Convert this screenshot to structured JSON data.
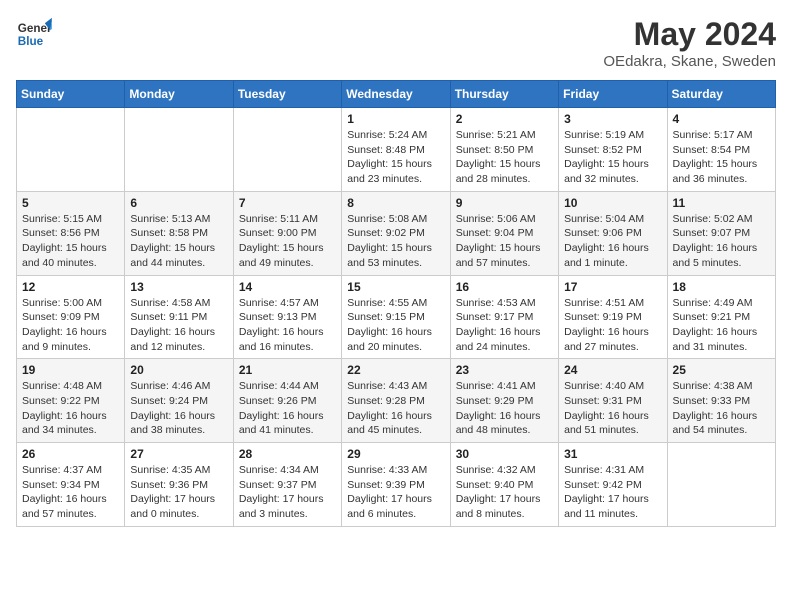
{
  "header": {
    "logo_line1": "General",
    "logo_line2": "Blue",
    "title": "May 2024",
    "subtitle": "OEdakra, Skane, Sweden"
  },
  "days_of_week": [
    "Sunday",
    "Monday",
    "Tuesday",
    "Wednesday",
    "Thursday",
    "Friday",
    "Saturday"
  ],
  "weeks": [
    [
      {
        "day": "",
        "info": ""
      },
      {
        "day": "",
        "info": ""
      },
      {
        "day": "",
        "info": ""
      },
      {
        "day": "1",
        "info": "Sunrise: 5:24 AM\nSunset: 8:48 PM\nDaylight: 15 hours and 23 minutes."
      },
      {
        "day": "2",
        "info": "Sunrise: 5:21 AM\nSunset: 8:50 PM\nDaylight: 15 hours and 28 minutes."
      },
      {
        "day": "3",
        "info": "Sunrise: 5:19 AM\nSunset: 8:52 PM\nDaylight: 15 hours and 32 minutes."
      },
      {
        "day": "4",
        "info": "Sunrise: 5:17 AM\nSunset: 8:54 PM\nDaylight: 15 hours and 36 minutes."
      }
    ],
    [
      {
        "day": "5",
        "info": "Sunrise: 5:15 AM\nSunset: 8:56 PM\nDaylight: 15 hours and 40 minutes."
      },
      {
        "day": "6",
        "info": "Sunrise: 5:13 AM\nSunset: 8:58 PM\nDaylight: 15 hours and 44 minutes."
      },
      {
        "day": "7",
        "info": "Sunrise: 5:11 AM\nSunset: 9:00 PM\nDaylight: 15 hours and 49 minutes."
      },
      {
        "day": "8",
        "info": "Sunrise: 5:08 AM\nSunset: 9:02 PM\nDaylight: 15 hours and 53 minutes."
      },
      {
        "day": "9",
        "info": "Sunrise: 5:06 AM\nSunset: 9:04 PM\nDaylight: 15 hours and 57 minutes."
      },
      {
        "day": "10",
        "info": "Sunrise: 5:04 AM\nSunset: 9:06 PM\nDaylight: 16 hours and 1 minute."
      },
      {
        "day": "11",
        "info": "Sunrise: 5:02 AM\nSunset: 9:07 PM\nDaylight: 16 hours and 5 minutes."
      }
    ],
    [
      {
        "day": "12",
        "info": "Sunrise: 5:00 AM\nSunset: 9:09 PM\nDaylight: 16 hours and 9 minutes."
      },
      {
        "day": "13",
        "info": "Sunrise: 4:58 AM\nSunset: 9:11 PM\nDaylight: 16 hours and 12 minutes."
      },
      {
        "day": "14",
        "info": "Sunrise: 4:57 AM\nSunset: 9:13 PM\nDaylight: 16 hours and 16 minutes."
      },
      {
        "day": "15",
        "info": "Sunrise: 4:55 AM\nSunset: 9:15 PM\nDaylight: 16 hours and 20 minutes."
      },
      {
        "day": "16",
        "info": "Sunrise: 4:53 AM\nSunset: 9:17 PM\nDaylight: 16 hours and 24 minutes."
      },
      {
        "day": "17",
        "info": "Sunrise: 4:51 AM\nSunset: 9:19 PM\nDaylight: 16 hours and 27 minutes."
      },
      {
        "day": "18",
        "info": "Sunrise: 4:49 AM\nSunset: 9:21 PM\nDaylight: 16 hours and 31 minutes."
      }
    ],
    [
      {
        "day": "19",
        "info": "Sunrise: 4:48 AM\nSunset: 9:22 PM\nDaylight: 16 hours and 34 minutes."
      },
      {
        "day": "20",
        "info": "Sunrise: 4:46 AM\nSunset: 9:24 PM\nDaylight: 16 hours and 38 minutes."
      },
      {
        "day": "21",
        "info": "Sunrise: 4:44 AM\nSunset: 9:26 PM\nDaylight: 16 hours and 41 minutes."
      },
      {
        "day": "22",
        "info": "Sunrise: 4:43 AM\nSunset: 9:28 PM\nDaylight: 16 hours and 45 minutes."
      },
      {
        "day": "23",
        "info": "Sunrise: 4:41 AM\nSunset: 9:29 PM\nDaylight: 16 hours and 48 minutes."
      },
      {
        "day": "24",
        "info": "Sunrise: 4:40 AM\nSunset: 9:31 PM\nDaylight: 16 hours and 51 minutes."
      },
      {
        "day": "25",
        "info": "Sunrise: 4:38 AM\nSunset: 9:33 PM\nDaylight: 16 hours and 54 minutes."
      }
    ],
    [
      {
        "day": "26",
        "info": "Sunrise: 4:37 AM\nSunset: 9:34 PM\nDaylight: 16 hours and 57 minutes."
      },
      {
        "day": "27",
        "info": "Sunrise: 4:35 AM\nSunset: 9:36 PM\nDaylight: 17 hours and 0 minutes."
      },
      {
        "day": "28",
        "info": "Sunrise: 4:34 AM\nSunset: 9:37 PM\nDaylight: 17 hours and 3 minutes."
      },
      {
        "day": "29",
        "info": "Sunrise: 4:33 AM\nSunset: 9:39 PM\nDaylight: 17 hours and 6 minutes."
      },
      {
        "day": "30",
        "info": "Sunrise: 4:32 AM\nSunset: 9:40 PM\nDaylight: 17 hours and 8 minutes."
      },
      {
        "day": "31",
        "info": "Sunrise: 4:31 AM\nSunset: 9:42 PM\nDaylight: 17 hours and 11 minutes."
      },
      {
        "day": "",
        "info": ""
      }
    ]
  ]
}
